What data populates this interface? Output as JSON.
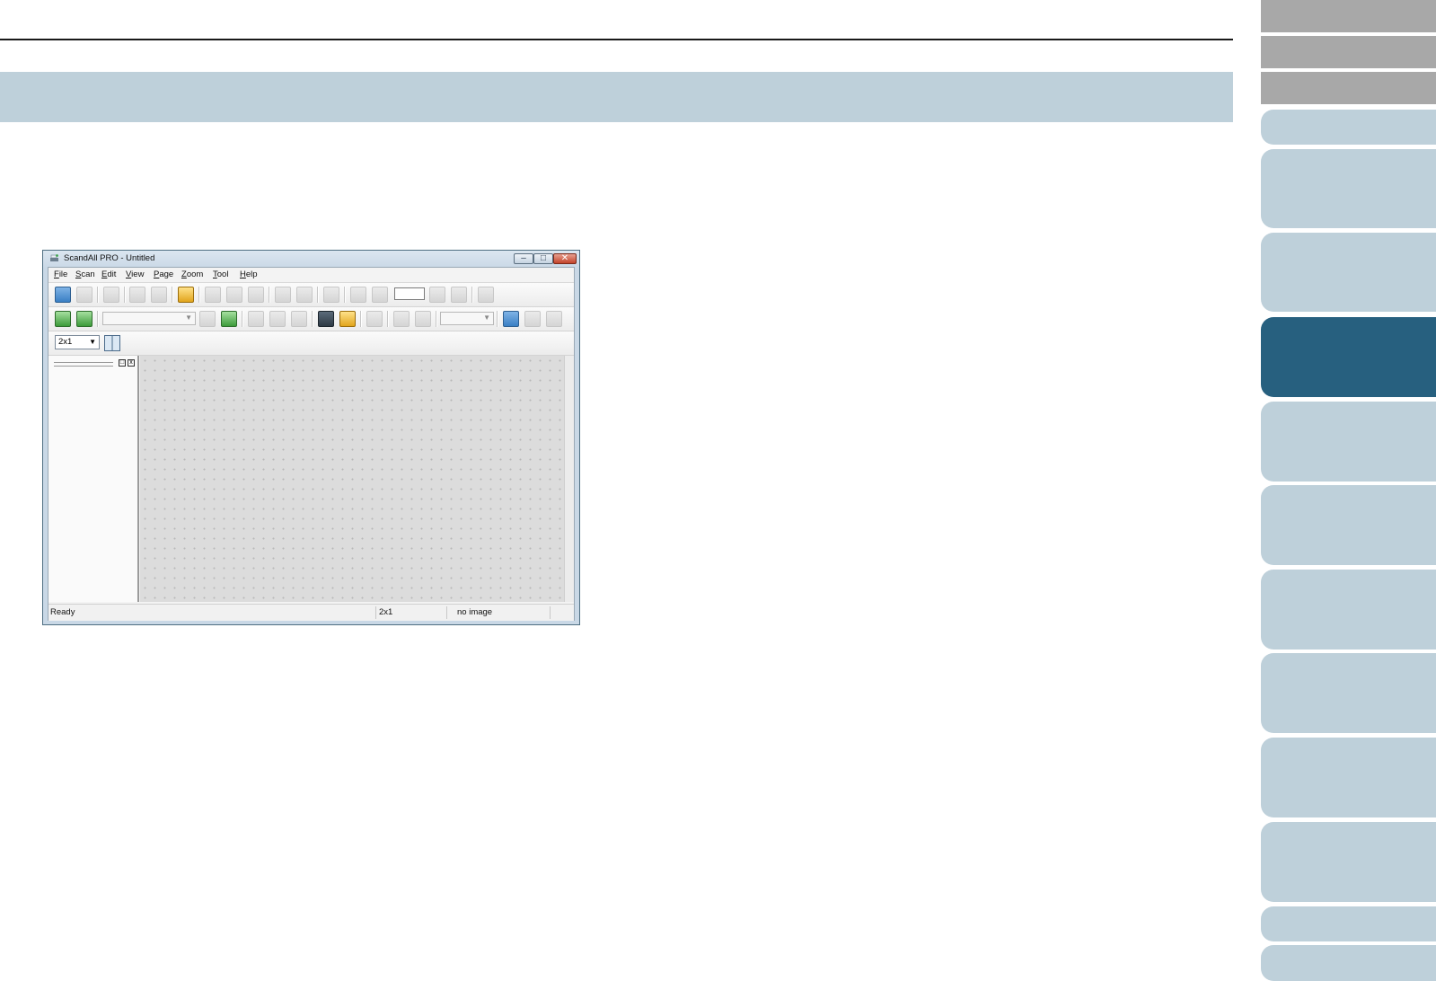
{
  "window": {
    "title": "ScandAll PRO - Untitled",
    "minimize_glyph": "–",
    "maximize_glyph": "□",
    "close_glyph": "✕"
  },
  "menu": [
    "File",
    "Scan",
    "Edit",
    "View",
    "Page",
    "Zoom",
    "Tool",
    "Help"
  ],
  "layout_select": {
    "value": "2x1"
  },
  "statusbar": {
    "status": "Ready",
    "layout": "2x1",
    "image": "no image"
  },
  "pane_buttons": {
    "float": "□",
    "close": "x"
  },
  "colors": {
    "section_band": "#bed0da",
    "tab_gray": "#a8a8a8",
    "tab_blue": "#bed0da",
    "tab_active": "#27607f"
  }
}
